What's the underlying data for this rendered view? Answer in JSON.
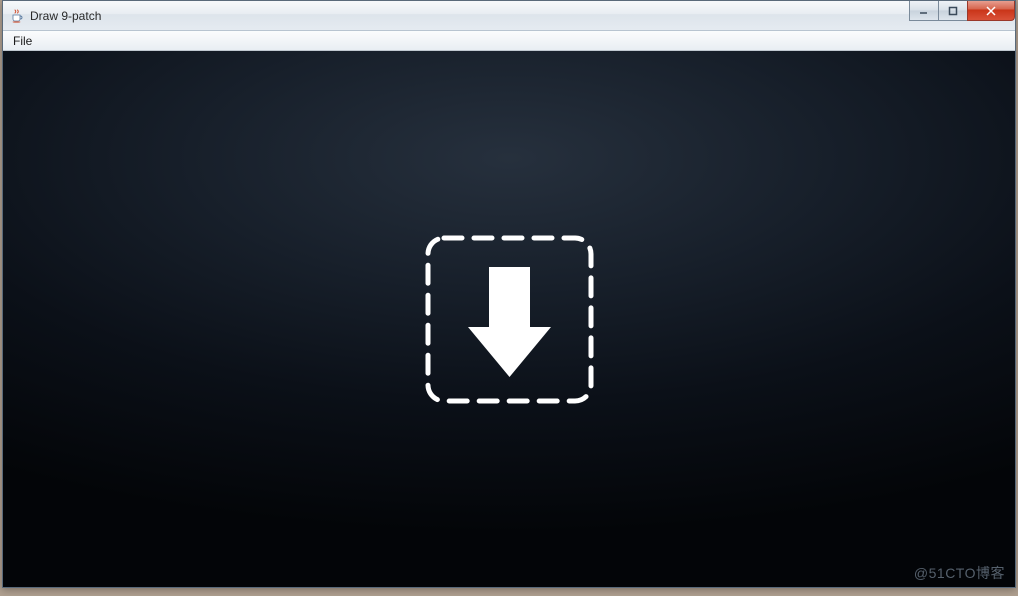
{
  "window": {
    "title": "Draw 9-patch"
  },
  "menubar": {
    "file": "File"
  },
  "icons": {
    "app": "java-cup-icon",
    "minimize": "minimize-icon",
    "maximize": "maximize-icon",
    "close": "close-icon",
    "drop": "drop-arrow-icon"
  },
  "watermark": "@51CTO博客"
}
